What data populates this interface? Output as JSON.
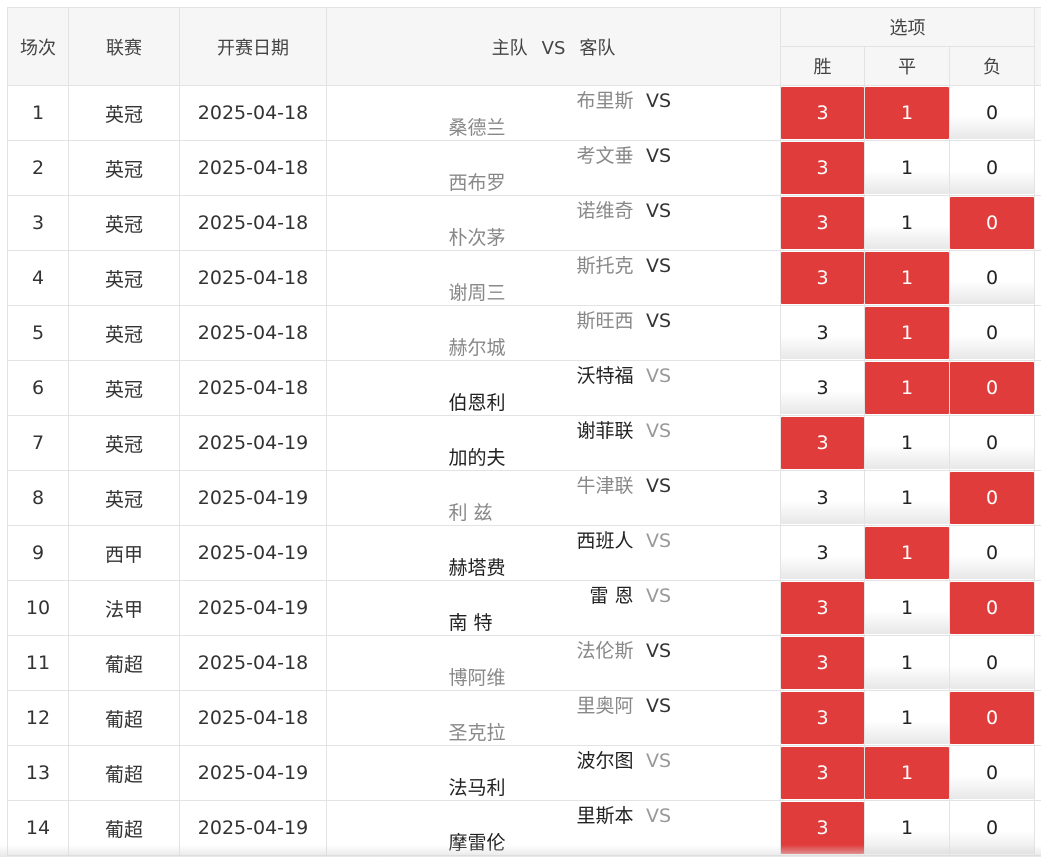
{
  "header": {
    "col_no": "场次",
    "col_league": "联赛",
    "col_date": "开赛日期",
    "col_home": "主队",
    "col_vs": "VS",
    "col_away": "客队",
    "col_options": "选项",
    "col_win": "胜",
    "col_draw": "平",
    "col_lose": "负"
  },
  "colors": {
    "selected": "#e03c3c",
    "header_bg": "#f6f6f6",
    "border": "#e3e3e3"
  },
  "rows": [
    {
      "no": "1",
      "league": "英冠",
      "date": "2025-04-18",
      "home": "布里斯",
      "vs": "VS",
      "away": "桑德兰",
      "win": "3",
      "draw": "1",
      "lose": "0",
      "win_on": true,
      "draw_on": true,
      "lose_on": false,
      "style": "muted"
    },
    {
      "no": "2",
      "league": "英冠",
      "date": "2025-04-18",
      "home": "考文垂",
      "vs": "VS",
      "away": "西布罗",
      "win": "3",
      "draw": "1",
      "lose": "0",
      "win_on": true,
      "draw_on": false,
      "lose_on": false,
      "style": "muted"
    },
    {
      "no": "3",
      "league": "英冠",
      "date": "2025-04-18",
      "home": "诺维奇",
      "vs": "VS",
      "away": "朴次茅",
      "win": "3",
      "draw": "1",
      "lose": "0",
      "win_on": true,
      "draw_on": false,
      "lose_on": true,
      "style": "muted"
    },
    {
      "no": "4",
      "league": "英冠",
      "date": "2025-04-18",
      "home": "斯托克",
      "vs": "VS",
      "away": "谢周三",
      "win": "3",
      "draw": "1",
      "lose": "0",
      "win_on": true,
      "draw_on": true,
      "lose_on": false,
      "style": "muted"
    },
    {
      "no": "5",
      "league": "英冠",
      "date": "2025-04-18",
      "home": "斯旺西",
      "vs": "VS",
      "away": "赫尔城",
      "win": "3",
      "draw": "1",
      "lose": "0",
      "win_on": false,
      "draw_on": true,
      "lose_on": false,
      "style": "muted"
    },
    {
      "no": "6",
      "league": "英冠",
      "date": "2025-04-18",
      "home": "沃特福",
      "vs": "VS",
      "away": "伯恩利",
      "win": "3",
      "draw": "1",
      "lose": "0",
      "win_on": false,
      "draw_on": true,
      "lose_on": true,
      "style": "bold"
    },
    {
      "no": "7",
      "league": "英冠",
      "date": "2025-04-19",
      "home": "谢菲联",
      "vs": "VS",
      "away": "加的夫",
      "win": "3",
      "draw": "1",
      "lose": "0",
      "win_on": true,
      "draw_on": false,
      "lose_on": false,
      "style": "bold"
    },
    {
      "no": "8",
      "league": "英冠",
      "date": "2025-04-19",
      "home": "牛津联",
      "vs": "VS",
      "away": "利 兹",
      "win": "3",
      "draw": "1",
      "lose": "0",
      "win_on": false,
      "draw_on": false,
      "lose_on": true,
      "style": "muted"
    },
    {
      "no": "9",
      "league": "西甲",
      "date": "2025-04-19",
      "home": "西班人",
      "vs": "VS",
      "away": "赫塔费",
      "win": "3",
      "draw": "1",
      "lose": "0",
      "win_on": false,
      "draw_on": true,
      "lose_on": false,
      "style": "bold"
    },
    {
      "no": "10",
      "league": "法甲",
      "date": "2025-04-19",
      "home": "雷 恩",
      "vs": "VS",
      "away": "南 特",
      "win": "3",
      "draw": "1",
      "lose": "0",
      "win_on": true,
      "draw_on": false,
      "lose_on": true,
      "style": "bold"
    },
    {
      "no": "11",
      "league": "葡超",
      "date": "2025-04-18",
      "home": "法伦斯",
      "vs": "VS",
      "away": "博阿维",
      "win": "3",
      "draw": "1",
      "lose": "0",
      "win_on": true,
      "draw_on": false,
      "lose_on": false,
      "style": "muted"
    },
    {
      "no": "12",
      "league": "葡超",
      "date": "2025-04-18",
      "home": "里奥阿",
      "vs": "VS",
      "away": "圣克拉",
      "win": "3",
      "draw": "1",
      "lose": "0",
      "win_on": true,
      "draw_on": false,
      "lose_on": true,
      "style": "muted"
    },
    {
      "no": "13",
      "league": "葡超",
      "date": "2025-04-19",
      "home": "波尔图",
      "vs": "VS",
      "away": "法马利",
      "win": "3",
      "draw": "1",
      "lose": "0",
      "win_on": true,
      "draw_on": true,
      "lose_on": false,
      "style": "bold"
    },
    {
      "no": "14",
      "league": "葡超",
      "date": "2025-04-19",
      "home": "里斯本",
      "vs": "VS",
      "away": "摩雷伦",
      "win": "3",
      "draw": "1",
      "lose": "0",
      "win_on": true,
      "draw_on": false,
      "lose_on": false,
      "style": "bold"
    }
  ]
}
